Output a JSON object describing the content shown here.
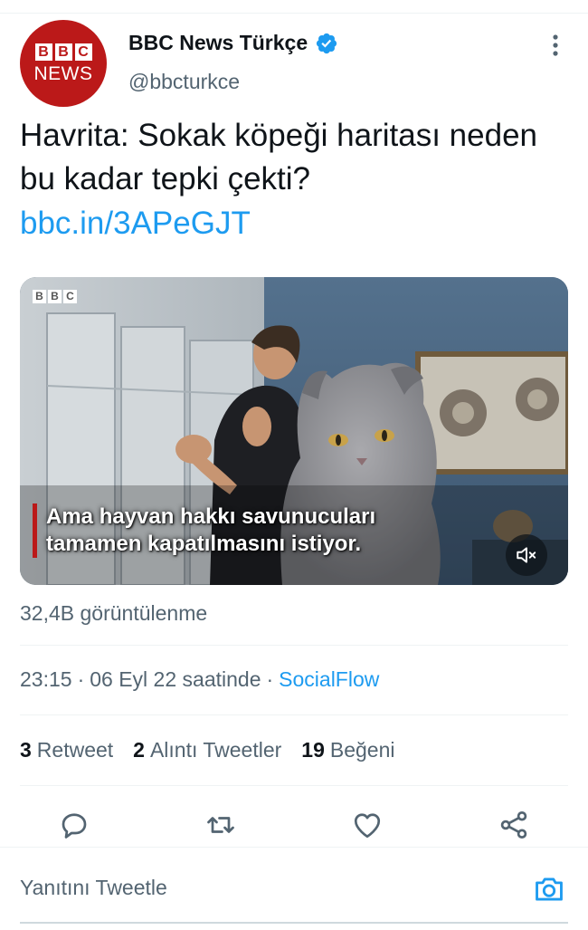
{
  "account": {
    "avatar_blocks": [
      "B",
      "B",
      "C"
    ],
    "avatar_text": "NEWS",
    "display_name": "BBC News Türkçe",
    "handle": "@bbcturkce",
    "verified_icon": "verified-badge-icon"
  },
  "tweet": {
    "text": "Havrita: Sokak köpeği haritası neden bu kadar tepki çekti?",
    "link": "bbc.in/3APeGJT"
  },
  "media": {
    "logo_blocks": [
      "B",
      "B",
      "C"
    ],
    "caption_line1": "Ama hayvan hakkı savunucuları",
    "caption_line2": "tamamen kapatılmasını istiyor.",
    "muted_icon": "speaker-muted-icon"
  },
  "views": "32,4B görüntülenme",
  "meta": {
    "time": "23:15",
    "sep1": "·",
    "date": "06 Eyl 22 saatinde",
    "sep2": "·",
    "source": "SocialFlow"
  },
  "stats": {
    "retweets_count": "3",
    "retweets_label": "Retweet",
    "quotes_count": "2",
    "quotes_label": "Alıntı Tweetler",
    "likes_count": "19",
    "likes_label": "Beğeni"
  },
  "actions": [
    "reply-icon",
    "retweet-icon",
    "like-icon",
    "share-icon"
  ],
  "reply": {
    "placeholder": "Yanıtını Tweetle",
    "camera_icon": "camera-icon"
  },
  "colors": {
    "accent": "#1d9bf0",
    "bbc_red": "#bb1919",
    "muted_text": "#536471"
  }
}
